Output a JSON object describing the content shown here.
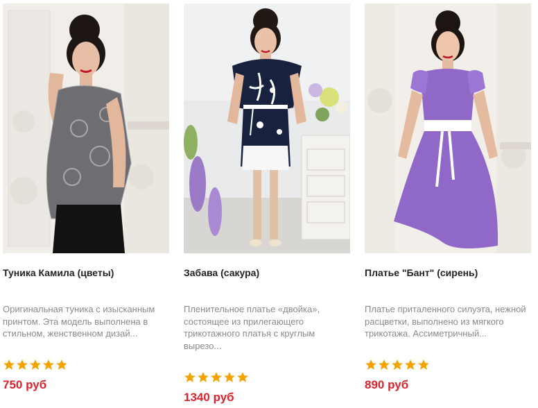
{
  "products": [
    {
      "title": "Туника Камила (цветы)",
      "description": "Оригинальная туника с изысканным принтом. Эта модель выполнена в стильном, женственном дизай...",
      "rating": 5,
      "price": "750 руб",
      "image": "model-grey-lace-tunic"
    },
    {
      "title": "Забава (сакура)",
      "description": "Пленительное платье «двойка», состоящее из прилегающего трикотажного платья с круглым вырезо...",
      "rating": 5,
      "price": "1340 руб",
      "image": "model-navy-sakura-dress"
    },
    {
      "title": "Платье \"Бант\" (сирень)",
      "description": "Платье приталенного силуэта, нежной расцветки, выполнено из мягкого трикотажа. Ассиметричный...",
      "rating": 5,
      "price": "890 руб",
      "image": "model-lilac-bow-dress"
    }
  ],
  "colors": {
    "price": "#d9232d",
    "star": "#f5a300",
    "title": "#222222",
    "description": "#8a8a8a"
  }
}
